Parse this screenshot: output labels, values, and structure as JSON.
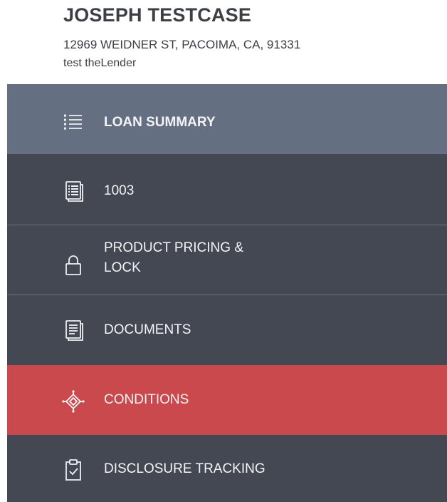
{
  "borrower": {
    "name": "JOSEPH TESTCASE",
    "address": "12969 WEIDNER ST, PACOIMA, CA, 91331",
    "lender": "test theLender"
  },
  "nav": {
    "items": [
      {
        "label": "LOAN SUMMARY",
        "icon": "list-icon",
        "state": "highlighted"
      },
      {
        "label": "1003",
        "icon": "form-icon",
        "state": "default"
      },
      {
        "label_line1": "PRODUCT PRICING &",
        "label_line2": "LOCK",
        "icon": "lock-icon",
        "state": "default"
      },
      {
        "label": "DOCUMENTS",
        "icon": "document-icon",
        "state": "default"
      },
      {
        "label": "CONDITIONS",
        "icon": "conditions-icon",
        "state": "active"
      },
      {
        "label": "DISCLOSURE TRACKING",
        "icon": "clipboard-check-icon",
        "state": "default"
      }
    ]
  },
  "colors": {
    "nav_background": "#434852",
    "summary_background": "#656f82",
    "active_background": "#c9494c",
    "divider": "#c9494c",
    "header_text": "#3c3f45"
  }
}
